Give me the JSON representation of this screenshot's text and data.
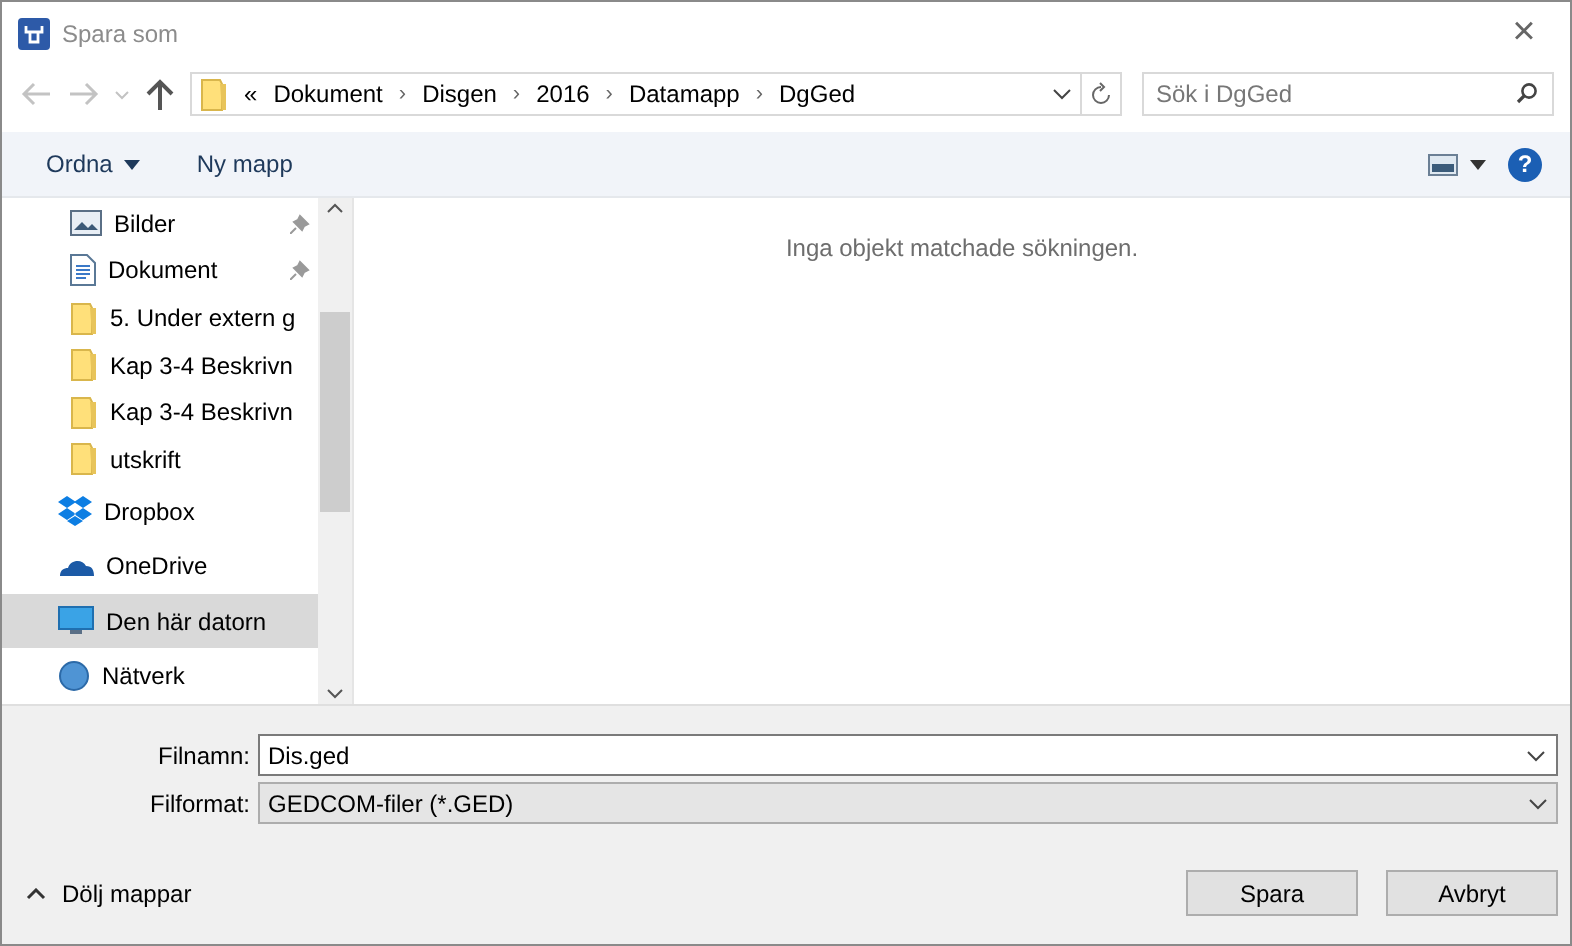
{
  "window": {
    "title": "Spara som",
    "close": "×"
  },
  "address": {
    "prefix": "«",
    "crumbs": [
      "Dokument",
      "Disgen",
      "2016",
      "Datamapp",
      "DgGed"
    ],
    "separator": "›"
  },
  "search": {
    "placeholder": "Sök i DgGed"
  },
  "toolbar": {
    "organize": "Ordna",
    "new_folder": "Ny mapp",
    "help": "?"
  },
  "nav": {
    "items": [
      {
        "label": "Bilder",
        "kind": "pictures",
        "pinned": true,
        "selected": false
      },
      {
        "label": "Dokument",
        "kind": "document",
        "pinned": true,
        "selected": false
      },
      {
        "label": "5. Under extern g",
        "kind": "folder",
        "pinned": false,
        "selected": false
      },
      {
        "label": "Kap 3-4 Beskrivn",
        "kind": "folder",
        "pinned": false,
        "selected": false
      },
      {
        "label": "Kap 3-4 Beskrivn",
        "kind": "folder",
        "pinned": false,
        "selected": false
      },
      {
        "label": "utskrift",
        "kind": "folder",
        "pinned": false,
        "selected": false
      },
      {
        "label": "Dropbox",
        "kind": "dropbox",
        "pinned": false,
        "selected": false
      },
      {
        "label": "OneDrive",
        "kind": "cloud",
        "pinned": false,
        "selected": false
      },
      {
        "label": "Den här datorn",
        "kind": "computer",
        "pinned": false,
        "selected": true
      },
      {
        "label": "Nätverk",
        "kind": "network",
        "pinned": false,
        "selected": false
      }
    ]
  },
  "content": {
    "empty_message": "Inga objekt matchade sökningen."
  },
  "form": {
    "filename_label": "Filnamn:",
    "filename": "Dis.ged",
    "format_label": "Filformat:",
    "format": "GEDCOM-filer (*.GED)"
  },
  "footer": {
    "hide_folders": "Dölj mappar",
    "buttons": [
      "Spara",
      "Avbryt"
    ]
  }
}
